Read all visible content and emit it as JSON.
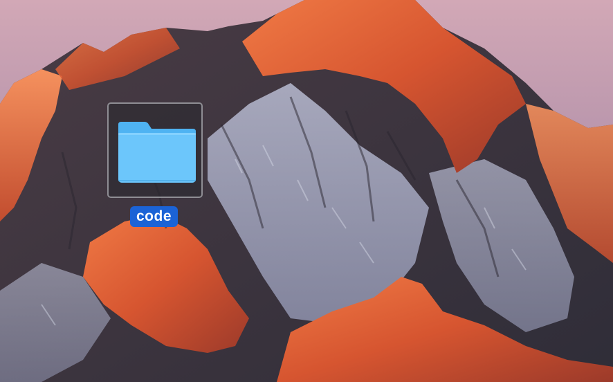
{
  "desktop": {
    "wallpaper": "sierra-mountain-sunset",
    "items": [
      {
        "label": "code",
        "icon": "folder-icon",
        "selected": true
      }
    ]
  },
  "colors": {
    "selection_label_bg": "#1b63d6",
    "folder_body": "#6cc6fb",
    "folder_tab": "#4fb3f2"
  }
}
